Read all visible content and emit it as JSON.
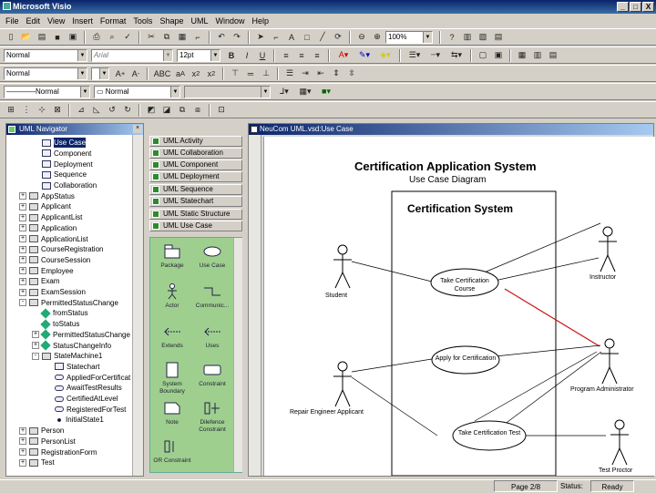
{
  "window": {
    "title": "Microsoft Visio",
    "controls": [
      "_",
      "□",
      "X"
    ]
  },
  "menu": [
    "File",
    "Edit",
    "View",
    "Insert",
    "Format",
    "Tools",
    "Shape",
    "UML",
    "Window",
    "Help"
  ],
  "toolbar": {
    "zoom": "100%"
  },
  "format_toolbar": {
    "style": "Normal",
    "font": "Arial",
    "size": "12pt"
  },
  "text_toolbar": {
    "style": "Normal"
  },
  "line_toolbar": {
    "line_style": "Normal",
    "fill_style": "Normal"
  },
  "navigator": {
    "title": "UML Navigator",
    "items": [
      {
        "label": "Use Case",
        "level": 1,
        "icon": "diagram",
        "selected": true
      },
      {
        "label": "Component",
        "level": 1,
        "icon": "diagram"
      },
      {
        "label": "Deployment",
        "level": 1,
        "icon": "diagram"
      },
      {
        "label": "Sequence",
        "level": 1,
        "icon": "diagram"
      },
      {
        "label": "Collaboration",
        "level": 1,
        "icon": "diagram"
      },
      {
        "label": "AppStatus",
        "level": 0,
        "icon": "package",
        "exp": "+"
      },
      {
        "label": "Applicant",
        "level": 0,
        "icon": "package",
        "exp": "+"
      },
      {
        "label": "ApplicantList",
        "level": 0,
        "icon": "package",
        "exp": "+"
      },
      {
        "label": "Application",
        "level": 0,
        "icon": "package",
        "exp": "+"
      },
      {
        "label": "ApplicationList",
        "level": 0,
        "icon": "package",
        "exp": "+"
      },
      {
        "label": "CourseRegistration",
        "level": 0,
        "icon": "package",
        "exp": "+"
      },
      {
        "label": "CourseSession",
        "level": 0,
        "icon": "package",
        "exp": "+"
      },
      {
        "label": "Employee",
        "level": 0,
        "icon": "package",
        "exp": "+"
      },
      {
        "label": "Exam",
        "level": 0,
        "icon": "package",
        "exp": "+"
      },
      {
        "label": "ExamSession",
        "level": 0,
        "icon": "package",
        "exp": "+"
      },
      {
        "label": "PermittedStatusChange",
        "level": 0,
        "icon": "package",
        "exp": "-"
      },
      {
        "label": "fromStatus",
        "level": 1,
        "icon": "attr"
      },
      {
        "label": "toStatus",
        "level": 1,
        "icon": "attr"
      },
      {
        "label": "PermittedStatusChange",
        "level": 1,
        "icon": "attr",
        "exp": "+"
      },
      {
        "label": "StatusChangeInfo",
        "level": 1,
        "icon": "attr",
        "exp": "+"
      },
      {
        "label": "StateMachine1",
        "level": 1,
        "icon": "package",
        "exp": "-"
      },
      {
        "label": "Statechart",
        "level": 2,
        "icon": "diagram"
      },
      {
        "label": "AppliedForCertificat",
        "level": 2,
        "icon": "shape"
      },
      {
        "label": "AwaitTestResults",
        "level": 2,
        "icon": "shape"
      },
      {
        "label": "CertifiedAtLevel",
        "level": 2,
        "icon": "shape"
      },
      {
        "label": "RegisteredForTest",
        "level": 2,
        "icon": "shape"
      },
      {
        "label": "InitialState1",
        "level": 2,
        "icon": "dot"
      },
      {
        "label": "Person",
        "level": 0,
        "icon": "package",
        "exp": "+"
      },
      {
        "label": "PersonList",
        "level": 0,
        "icon": "package",
        "exp": "+"
      },
      {
        "label": "RegistrationForm",
        "level": 0,
        "icon": "package",
        "exp": "+"
      },
      {
        "label": "Test",
        "level": 0,
        "icon": "package",
        "exp": "+"
      }
    ]
  },
  "shapes": {
    "stencils": [
      "UML Activity",
      "UML Collaboration",
      "UML Component",
      "UML Deployment",
      "UML Sequence",
      "UML Statechart",
      "UML Static Structure",
      "UML Use Case"
    ],
    "masters": [
      "Package",
      "Use Case",
      "Actor",
      "Communic...",
      "Extends",
      "Uses",
      "System Boundary",
      "Constraint",
      "Note",
      "Dilefence Constraint",
      "OR Constraint"
    ]
  },
  "drawing": {
    "window_title": "NeuCom UML.vsd:Use Case",
    "title": "Certification Application System",
    "subtitle": "Use Case Diagram",
    "boundary_label": "Certification System",
    "actors": [
      "Student",
      "Instructor",
      "Repair Engineer Applicant",
      "Program Administrator",
      "Test Proctor"
    ],
    "use_cases": [
      "Take Certification Course",
      "Apply for Certification",
      "Take Certification Test"
    ]
  },
  "status": {
    "page": "Page 2/8",
    "status_label": "Status:",
    "status_value": "Ready"
  }
}
